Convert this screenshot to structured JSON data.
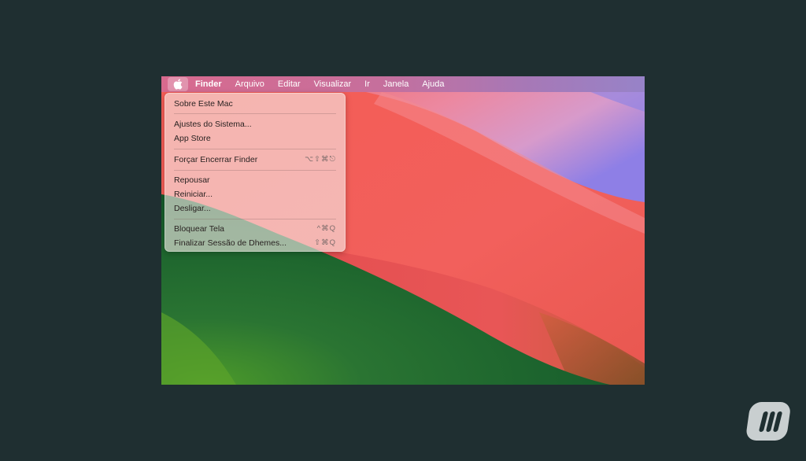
{
  "menubar": {
    "apple_icon": "apple-logo-icon",
    "items": [
      "Finder",
      "Arquivo",
      "Editar",
      "Visualizar",
      "Ir",
      "Janela",
      "Ajuda"
    ]
  },
  "apple_menu": {
    "about": "Sobre Este Mac",
    "settings": "Ajustes do Sistema...",
    "app_store": "App Store",
    "force_quit": "Forçar Encerrar Finder",
    "force_quit_shortcut": "⌥⇧⌘⎋",
    "sleep": "Repousar",
    "restart": "Reiniciar...",
    "shutdown": "Desligar...",
    "lock": "Bloquear Tela",
    "lock_shortcut": "^⌘Q",
    "logout": "Finalizar Sessão de Dhemes...",
    "logout_shortcut": "⇧⌘Q"
  },
  "colors": {
    "background": "#1f2f31",
    "wallpaper_green": "#1e5b2c",
    "wallpaper_red": "#f25a5a",
    "wallpaper_pink": "#ee8fa3",
    "wallpaper_purple": "#9a82e0",
    "brand_logo": "#c9cfd0"
  },
  "brand": {
    "icon": "brand-logo-icon"
  }
}
